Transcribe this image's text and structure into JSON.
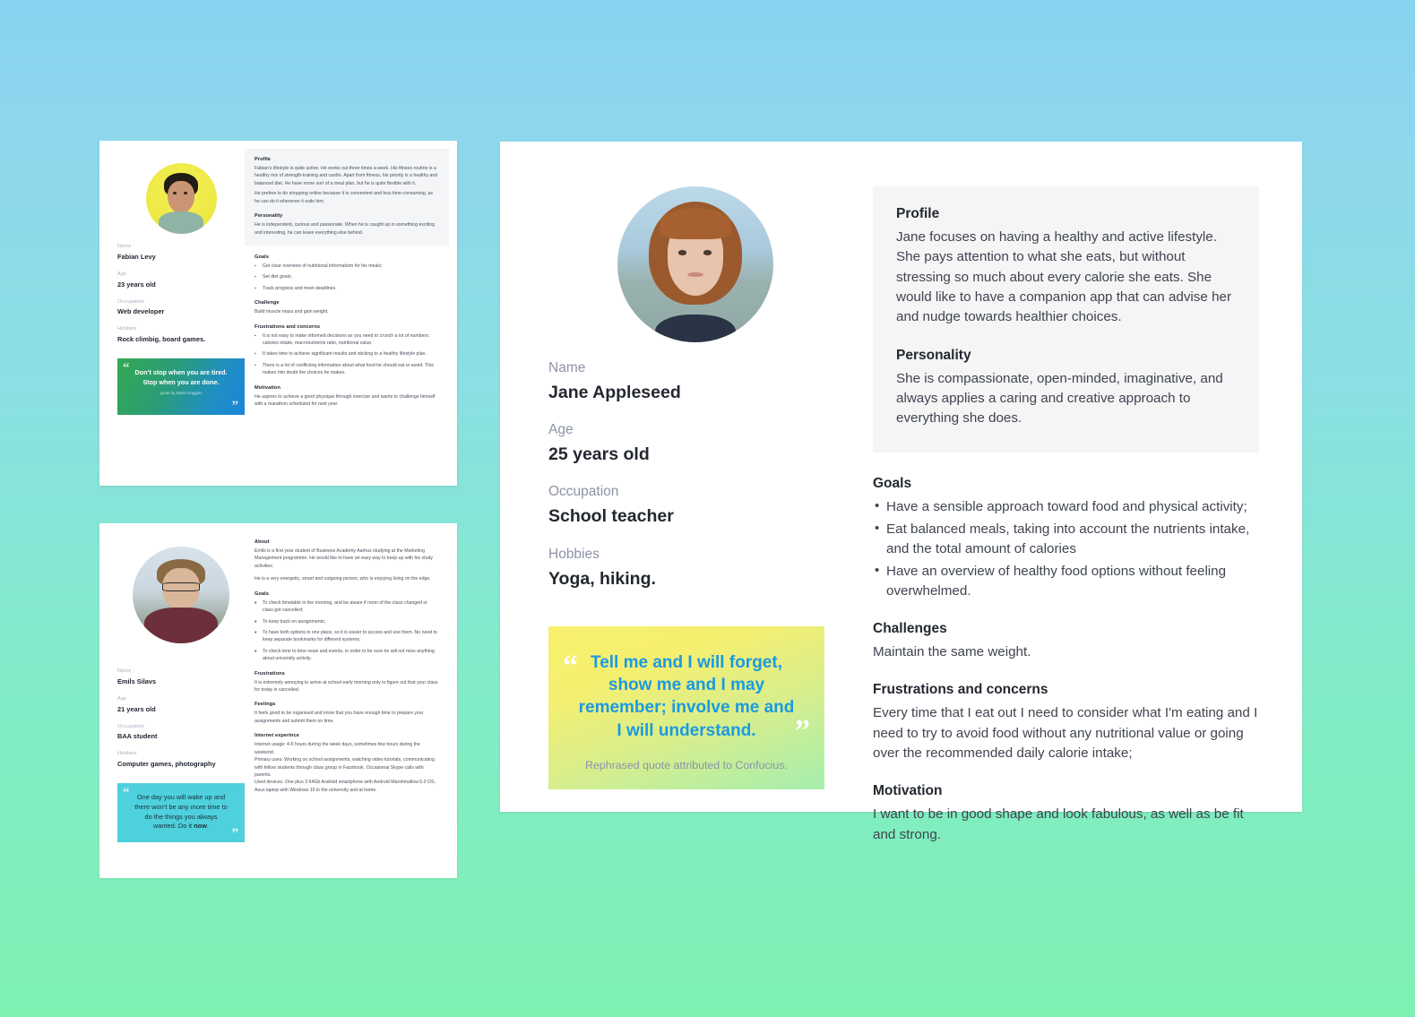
{
  "background": {
    "top_color": "#86d3ef",
    "bottom_color": "#7df1b2"
  },
  "cards": {
    "fabian": {
      "avatar": "fabian-portrait",
      "fields": [
        {
          "label": "Name",
          "value": "Fabian Levy"
        },
        {
          "label": "Age",
          "value": "23 years old"
        },
        {
          "label": "Occupation",
          "value": "Web developer"
        },
        {
          "label": "Hobbies",
          "value": "Rock climbig, board games."
        }
      ],
      "quote": {
        "text": "Don’t stop when you are tired. Stop when you are done.",
        "attribution": "quote by David Goggins",
        "open_mark": "“",
        "close_mark": "”",
        "accent_from": "#34a853",
        "accent_to": "#1a86d8"
      },
      "sections": {
        "profile_heading": "Profile",
        "profile_p1": "Fabian’s lifestyle is quite active. He works out three times a week. His fitness routine is a healthy mix of strength-training and cardio. Apart from fitness, his priority is a healthy and balanced diet. He have some sort of a meal plan, but he is quite flexible with it.",
        "profile_p2": "He prefers to do shopping online because it is convenient and less time-consuming, as he can do it whenever it suits him.",
        "personality_heading": "Personality",
        "personality_p": "He is independent, curious and passionate. When he is caught up in something exciting and interesting, he can leave everything else behind.",
        "goals_heading": "Goals",
        "goals": [
          "Get clear overview of nutritional informatiom for his meals;",
          "Set diet goals;",
          "Track progress and meet deadlines."
        ],
        "challenge_heading": "Challenge",
        "challenge_p": "Build muscle mass and gain weight.",
        "frustrations_heading": "Frustrations and concerns",
        "frustrations": [
          "It is not easy to make informed decisions as you need to crunch a lot of numbers: calories intake, macronutrients ratio, nutritional value.",
          "It takes time to achieve significant results and sticking to a healthy lifestyle plan.",
          "There is a lot of conflicting information about what food he should eat or avoid. This makes him doubt the choices he makes."
        ],
        "motivation_heading": "Motivation",
        "motivation_p": "He aspires to achieve a good physique through exercise and wants to challenge himself with a marathon scheduled for next year."
      }
    },
    "emils": {
      "avatar": "emils-portrait",
      "fields": [
        {
          "label": "Name",
          "value": "Emils Silavs"
        },
        {
          "label": "Age",
          "value": "21 years old"
        },
        {
          "label": "Occupation",
          "value": "BAA student"
        },
        {
          "label": "Hobbies",
          "value": "Computer games, photography"
        }
      ],
      "quote": {
        "text_before_bold": "One day you will wake up and there won’t be any more time to do the things you always wanted. Do it ",
        "text_bold": "now",
        "text_after_bold": ".",
        "open_mark": "“",
        "close_mark": "”",
        "accent": "#4fd0dd"
      },
      "sections": {
        "about_heading": "About",
        "about_p1": "Emils is a first year student of Business Academy Aarhus studying at the Marketing Management programme. He would like to have an easy way to keep up with his study activities.",
        "about_p2": "He is a very energetic, smart and outgoing person, who is enjoying living on the edge.",
        "goals_heading": "Goals",
        "goals": [
          "To check timetable in the morning, and be aware if room of the class changed or class got cancelled;",
          "To keep track on assignments;",
          "To have both options in one place, so it is easier to access and use them. No need to keep separate bookmarks for different systems;",
          "To check time to time news and events, in order to be sure he will not miss anything about university activity."
        ],
        "frustrations_heading": "Frustrations",
        "frustrations_p": "It is extremely annoying to arrive at school early morning only to figure out that your class for today is cancelled.",
        "feelings_heading": "Feelings",
        "feelings_p": "It feels good to be organised and know that you have enough time to prepare your assignments and submit them on time.",
        "internet_heading": "Internet experince",
        "internet_p1": "Internet usage: 4-5 hours during the week days, sometimes few hours during the weekend.",
        "internet_p2": "Primary uses: Working on school assignments, watching video tutorials, communicating with fellow students through class group in Facebook. Occasional Skype calls with parents.",
        "internet_p3": "Used devices: One plus 3 64Gb Android smartphone with Android Marshmallow 6.0 OS, Asus laptop with Windows 10 in the university and at home."
      }
    },
    "jane": {
      "avatar": "jane-portrait",
      "fields": [
        {
          "label": "Name",
          "value": "Jane Appleseed"
        },
        {
          "label": "Age",
          "value": "25 years old"
        },
        {
          "label": "Occupation",
          "value": "School teacher"
        },
        {
          "label": "Hobbies",
          "value": "Yoga, hiking."
        }
      ],
      "quote": {
        "text": "Tell me and I will forget, show me and I may remember; involve me and I will understand.",
        "attribution": "Rephrased quote attributed to Confucius.",
        "open_mark": "“",
        "close_mark": "”",
        "text_color": "#1b9ae0",
        "bg_from": "#f7f06e",
        "bg_to": "#a5eeae"
      },
      "sections": {
        "profile_heading": "Profile",
        "profile_p": "Jane focuses on having a healthy and active lifestyle. She pays attention to what she eats, but without stressing so much about every calorie she eats. She would like to have a companion app that can advise her and nudge towards healthier choices.",
        "personality_heading": "Personality",
        "personality_p": "She is compassionate, open-minded, imaginative, and always applies a caring and creative approach to everything she does.",
        "goals_heading": "Goals",
        "goals": [
          "Have a sensible approach toward food and physical activity;",
          "Eat balanced meals, taking into account the nutrients intake, and the total amount of calories",
          "Have an overview of healthy food options without feeling overwhelmed."
        ],
        "challenges_heading": "Challenges",
        "challenges_p": "Maintain the same weight.",
        "frustrations_heading": "Frustrations and concerns",
        "frustrations_p": "Every time that I eat out I need to consider what I'm eating and I need to try to avoid food without any nutritional value or going over the recommended daily calorie intake;",
        "motivation_heading": "Motivation",
        "motivation_p": "I want to be in good shape and look fabulous, as well as be fit and strong."
      }
    }
  }
}
